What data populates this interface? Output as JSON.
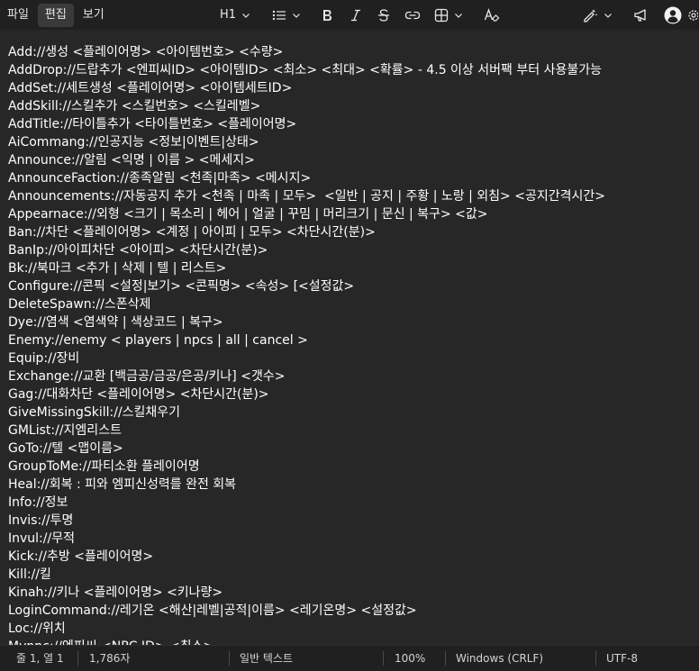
{
  "menu": {
    "file": "파일",
    "edit": "편집",
    "view": "보기"
  },
  "toolbar": {
    "heading": "H1"
  },
  "editor": {
    "lines": [
      "Add://생성 <플레이어명> <아이템번호> <수량>",
      "AddDrop://드랍추가 <엔피씨ID> <아이템ID> <최소> <최대> <확률> - 4.5 이상 서버팩 부터 사용불가능",
      "AddSet://세트생성 <플레이어명> <아이템세트ID>",
      "AddSkill://스킬추가 <스킬번호> <스킬레벨>",
      "AddTitle://타이틀추가 <타이틀번호> <플레이어명>",
      "AiCommang://인공지능 <정보|이벤트|상태>",
      "Announce://알림 <익명 | 이름 > <메세지>",
      "AnnounceFaction://종족알림 <천족|마족> <메시지>",
      "Announcements://자동공지 추가 <천족 | 마족 | 모두>  <일반 | 공지 | 주황 | 노랑 | 외침> <공지간격시간>",
      "Appearnace://외형 <크기 | 목소리 | 헤어 | 얼굴 | 꾸밈 | 머리크기 | 문신 | 복구> <값>",
      "Ban://차단 <플레이어명> <계정 | 아이피 | 모두> <차단시간(분)>",
      "BanIp://아이피차단 <아이피> <차단시간(분)>",
      "Bk://북마크 <추가 | 삭제 | 텔 | 리스트>",
      "Configure://콘픽 <설정|보기> <콘픽명> <속성> [<설정값>",
      "DeleteSpawn://스폰삭제",
      "Dye://염색 <염색약 | 색상코드 | 복구>",
      "Enemy://enemy < players | npcs | all | cancel >",
      "Equip://장비",
      "Exchange://교환 [백금공/금공/은공/키나] <갯수>",
      "Gag://대화차단 <플레이어명> <차단시간(분)>",
      "GiveMissingSkill://스킬채우기",
      "GMList://지엠리스트",
      "GoTo://텔 <맵이름>",
      "GroupToMe://파티소환 플레이어명",
      "Heal://회복 : 피와 엠피신성력를 완전 회복",
      "Info://정보",
      "Invis://투명",
      "Invul://무적",
      "Kick://추방 <플레이어명>",
      "Kill://킬",
      "Kinah://키나 <플레이어명> <키나량>",
      "LoginCommand://레기온 <해산|레벨|공적|이름> <레기온명> <설정값>",
      "Loc://위치",
      "Mynpc://엔피씨 <NPC ID> <최소>"
    ]
  },
  "status": {
    "position": "줄 1, 열 1",
    "chars": "1,786자",
    "format": "일반 텍스트",
    "zoom": "100%",
    "line_ending": "Windows (CRLF)",
    "encoding": "UTF-8"
  }
}
